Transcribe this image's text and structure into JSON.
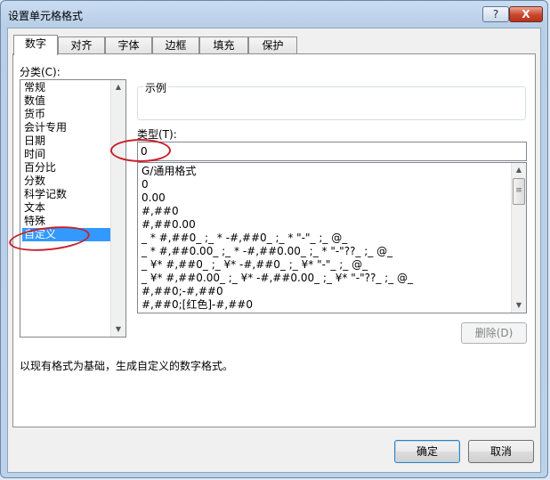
{
  "window": {
    "title": "设置单元格格式",
    "help_label": "?",
    "close_label": "X"
  },
  "tabs": [
    {
      "label": "数字",
      "active": true
    },
    {
      "label": "对齐",
      "active": false
    },
    {
      "label": "字体",
      "active": false
    },
    {
      "label": "边框",
      "active": false
    },
    {
      "label": "填充",
      "active": false
    },
    {
      "label": "保护",
      "active": false
    }
  ],
  "category": {
    "label": "分类(C):",
    "items": [
      "常规",
      "数值",
      "货币",
      "会计专用",
      "日期",
      "时间",
      "百分比",
      "分数",
      "科学记数",
      "文本",
      "特殊",
      "自定义"
    ],
    "selected": "自定义"
  },
  "sample": {
    "label": "示例"
  },
  "type": {
    "label": "类型(T):",
    "value": "0",
    "formats": [
      "G/通用格式",
      "0",
      "0.00",
      "#,##0",
      "#,##0.00",
      "_ * #,##0_ ;_ * -#,##0_ ;_ * \"-\"_ ;_ @_",
      "_ * #,##0.00_ ;_ * -#,##0.00_ ;_ * \"-\"??_ ;_ @_",
      "_ ¥* #,##0_ ;_ ¥* -#,##0_ ;_ ¥* \"-\"_ ;_ @_",
      "_ ¥* #,##0.00_ ;_ ¥* -#,##0.00_ ;_ ¥* \"-\"??_ ;_ @_",
      "#,##0;-#,##0",
      "#,##0;[红色]-#,##0"
    ]
  },
  "delete_button": "删除(D)",
  "description": "以现有格式为基础，生成自定义的数字格式。",
  "footer": {
    "ok_label": "确定",
    "cancel_label": "取消"
  },
  "colors": {
    "selection": "#3399ff",
    "annotation": "#c8202a",
    "title_bg": "#c9dcf1"
  }
}
